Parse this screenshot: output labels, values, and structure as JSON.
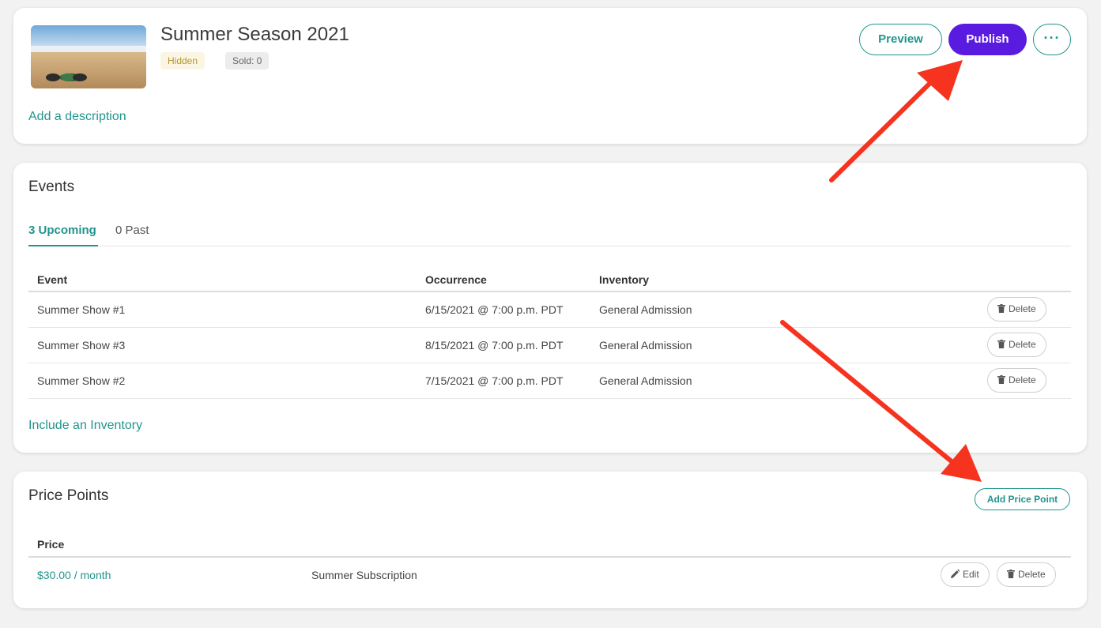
{
  "header": {
    "title": "Summer Season 2021",
    "status_badge": "Hidden",
    "sold_badge": "Sold: 0",
    "add_description": "Add a description",
    "preview_label": "Preview",
    "publish_label": "Publish",
    "more_label": "···"
  },
  "events": {
    "title": "Events",
    "tabs": [
      {
        "label": "3 Upcoming",
        "active": true
      },
      {
        "label": "0 Past",
        "active": false
      }
    ],
    "columns": [
      "Event",
      "Occurrence",
      "Inventory"
    ],
    "rows": [
      {
        "event": "Summer Show #1",
        "occurrence": "6/15/2021 @ 7:00 p.m. PDT",
        "inventory": "General Admission",
        "action": "Delete"
      },
      {
        "event": "Summer Show #3",
        "occurrence": "8/15/2021 @ 7:00 p.m. PDT",
        "inventory": "General Admission",
        "action": "Delete"
      },
      {
        "event": "Summer Show #2",
        "occurrence": "7/15/2021 @ 7:00 p.m. PDT",
        "inventory": "General Admission",
        "action": "Delete"
      }
    ],
    "include_inventory": "Include an Inventory"
  },
  "price_points": {
    "title": "Price Points",
    "add_label": "Add Price Point",
    "columns": [
      "Price"
    ],
    "rows": [
      {
        "price": "$30.00 / month",
        "name": "Summer Subscription",
        "edit": "Edit",
        "delete": "Delete"
      }
    ]
  },
  "colors": {
    "accent": "#20958c",
    "publish": "#5a1be0",
    "arrow": "#f5331f"
  }
}
